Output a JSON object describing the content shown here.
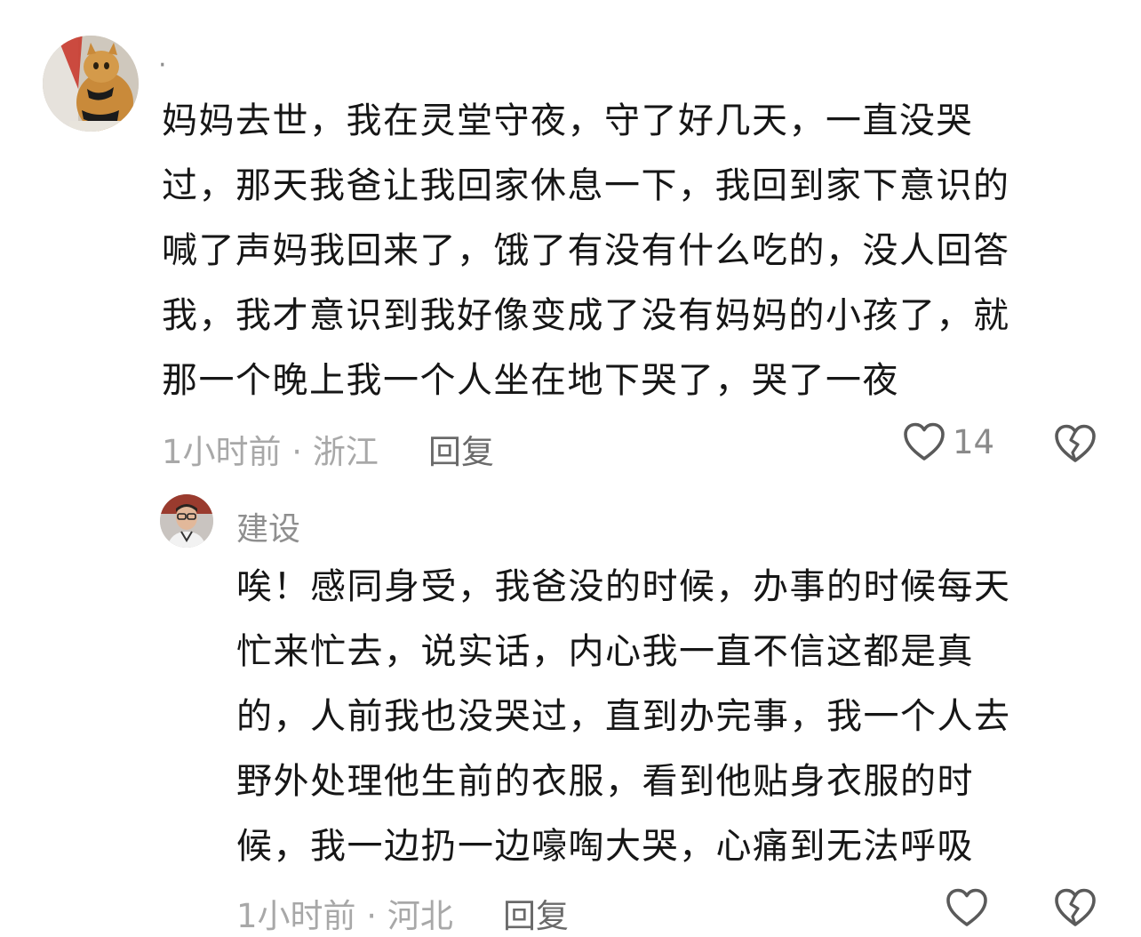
{
  "comments": [
    {
      "username": "·",
      "lines": [
        "妈妈去世，我在灵堂守夜，守了好几天，一直没哭",
        "过，那天我爸让我回家休息一下，我回到家下意识的",
        "喊了声妈我回来了，饿了有没有什么吃的，没人回答",
        "我，我才意识到我好像变成了没有妈妈的小孩了，就",
        "那一个晚上我一个人坐在地下哭了，哭了一夜"
      ],
      "meta": "1小时前 · 浙江",
      "reply_label": "回复",
      "like_count": "14",
      "avatar_icon": "cat-avatar-icon"
    },
    {
      "username": "建设",
      "lines": [
        "唉！感同身受，我爸没的时候，办事的时候每天",
        "忙来忙去，说实话，内心我一直不信这都是真",
        "的，人前我也没哭过，直到办完事，我一个人去",
        "野外处理他生前的衣服，看到他贴身衣服的时",
        "候，我一边扔一边嚎啕大哭，心痛到无法呼吸"
      ],
      "meta": "1小时前 · 河北",
      "reply_label": "回复",
      "like_count": "",
      "avatar_icon": "man-avatar-icon"
    }
  ],
  "colors": {
    "text": "#161616",
    "meta": "#a8a8a8",
    "reply": "#6a6a6a",
    "icon": "#5a5a5a"
  }
}
